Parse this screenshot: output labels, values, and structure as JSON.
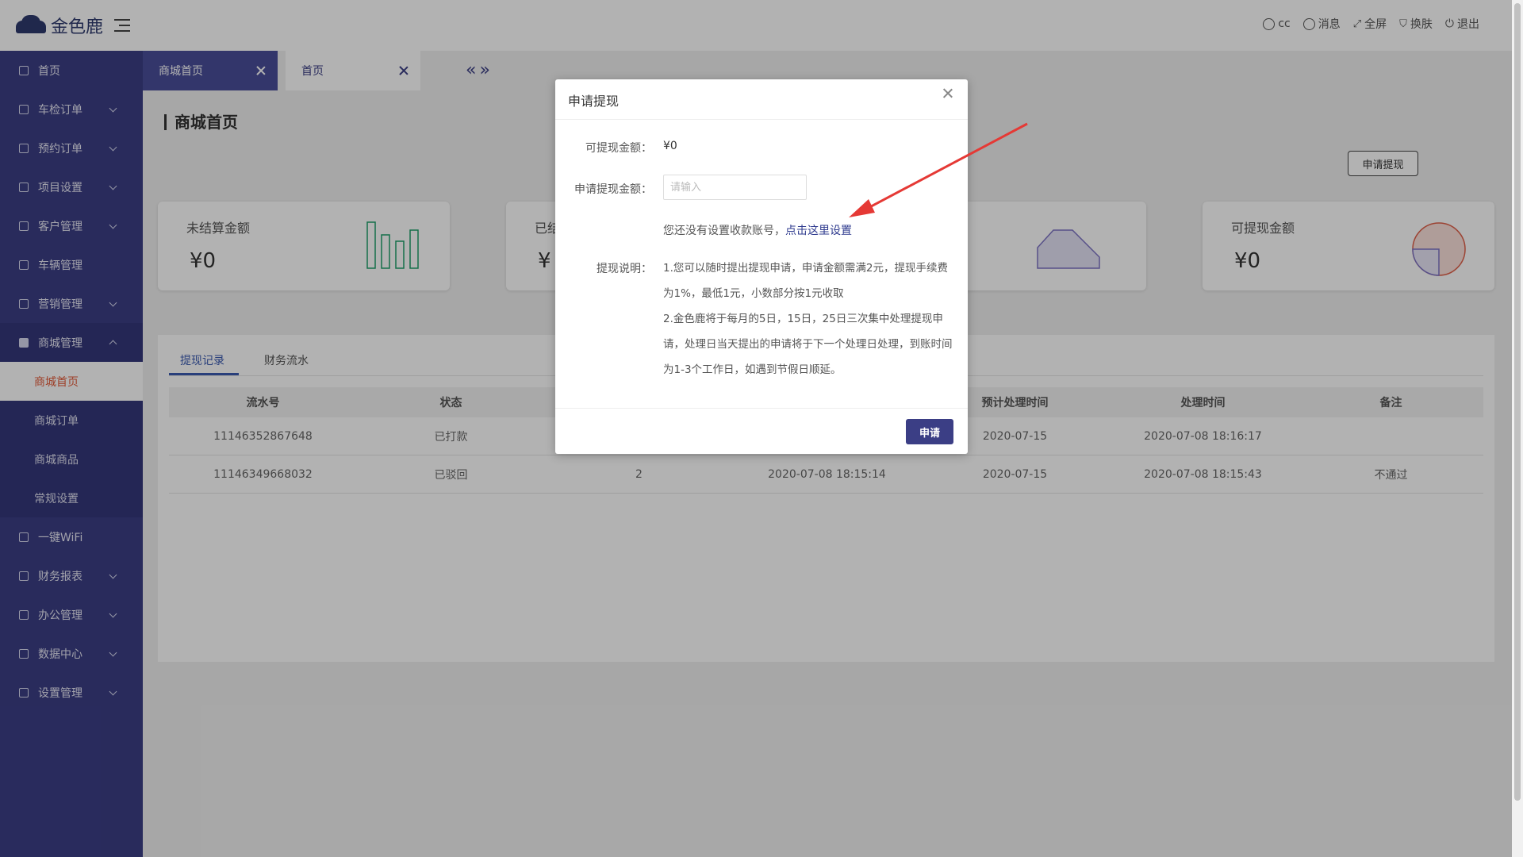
{
  "app": {
    "name": "金色鹿"
  },
  "header": {
    "items": [
      {
        "icon": "user-icon",
        "label": "cc"
      },
      {
        "icon": "message-icon",
        "label": "消息"
      },
      {
        "icon": "fullscreen-icon",
        "label": "全屏"
      },
      {
        "icon": "shirt-icon",
        "label": "换肤"
      },
      {
        "icon": "power-icon",
        "label": "退出"
      }
    ]
  },
  "sidebar": {
    "items": [
      {
        "label": "首页"
      },
      {
        "label": "车检订单"
      },
      {
        "label": "预约订单"
      },
      {
        "label": "项目设置"
      },
      {
        "label": "客户管理"
      },
      {
        "label": "车辆管理"
      },
      {
        "label": "营销管理"
      },
      {
        "label": "商城管理"
      },
      {
        "label": "一键WiFi"
      },
      {
        "label": "财务报表"
      },
      {
        "label": "办公管理"
      },
      {
        "label": "数据中心"
      },
      {
        "label": "设置管理"
      }
    ],
    "sub_items": [
      {
        "label": "商城首页"
      },
      {
        "label": "商城订单"
      },
      {
        "label": "商城商品"
      },
      {
        "label": "常规设置"
      }
    ]
  },
  "tabs": [
    {
      "label": "商城首页"
    },
    {
      "label": "首页"
    }
  ],
  "main": {
    "title": "商城首页",
    "apply_button": "申请提现",
    "cards": [
      {
        "title": "未结算金额",
        "value": "¥0",
        "color": "#1e9f6a"
      },
      {
        "title": "已结",
        "value": "¥"
      },
      {
        "title": "",
        "value": "",
        "color": "#7d73c4"
      },
      {
        "title": "可提现金额",
        "value": "¥0",
        "color": "#e0614a"
      }
    ],
    "panel_tabs": [
      "提现记录",
      "财务流水"
    ],
    "table": {
      "columns": [
        "流水号",
        "状态",
        "",
        "",
        "预计处理时间",
        "处理时间",
        "备注"
      ],
      "rows": [
        [
          "11146352867648",
          "已打款",
          "",
          "",
          "2020-07-15",
          "2020-07-08 18:16:17",
          ""
        ],
        [
          "11146349668032",
          "已驳回",
          "2",
          "2020-07-08 18:15:14",
          "2020-07-15",
          "2020-07-08 18:15:43",
          "不通过"
        ]
      ]
    }
  },
  "dialog": {
    "title": "申请提现",
    "available_label": "可提现金额：",
    "available_value": "¥0",
    "amount_label": "申请提现金额：",
    "amount_placeholder": "请输入",
    "no_account_text": "您还没有设置收款账号，",
    "setup_link": "点击这里设置",
    "desc_label": "提现说明：",
    "desc_line1": "1.您可以随时提出提现申请，申请金额需满2元，提现手续费为1%，最低1元，小数部分按1元收取",
    "desc_line2": "2.金色鹿将于每月的5日，15日，25日三次集中处理提现申请，处理日当天提出的申请将于下一个处理日处理，到账时间为1-3个工作日，如遇到节假日顺延。",
    "submit": "申请"
  },
  "colors": {
    "sidebar": "#3b3e85",
    "accent": "#3b3e85",
    "arrow": "#e53935",
    "selected_text": "#e25b3a"
  }
}
